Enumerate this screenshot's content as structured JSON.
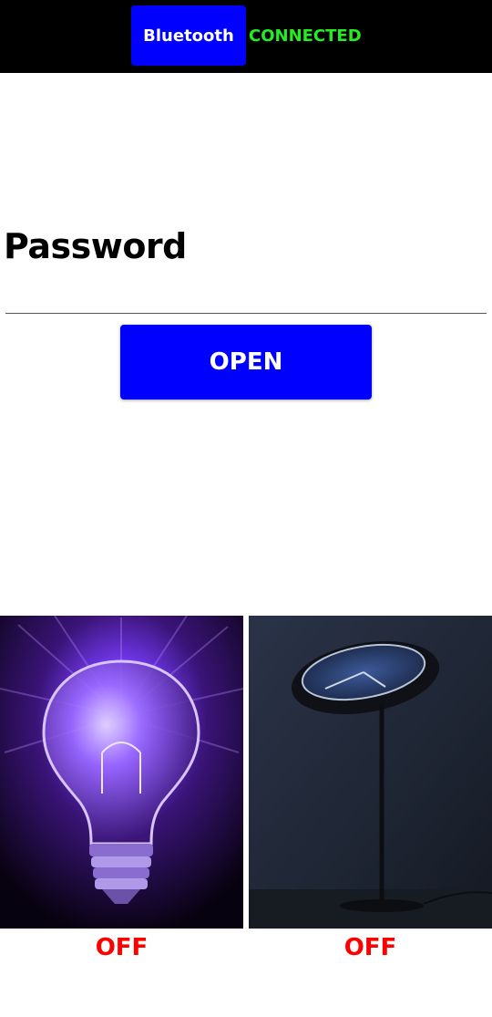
{
  "header": {
    "bluetooth_label": "Bluetooth",
    "status_text": "CONNECTED",
    "status_color": "#22ee22",
    "button_color": "#0000ff"
  },
  "login": {
    "password_label": "Password",
    "password_value": "",
    "open_label": "OPEN"
  },
  "devices": [
    {
      "image": "light-bulb",
      "state": "OFF"
    },
    {
      "image": "floor-lamp",
      "state": "OFF"
    }
  ],
  "colors": {
    "state_off": "#ff0000",
    "accent": "#0000ff"
  }
}
